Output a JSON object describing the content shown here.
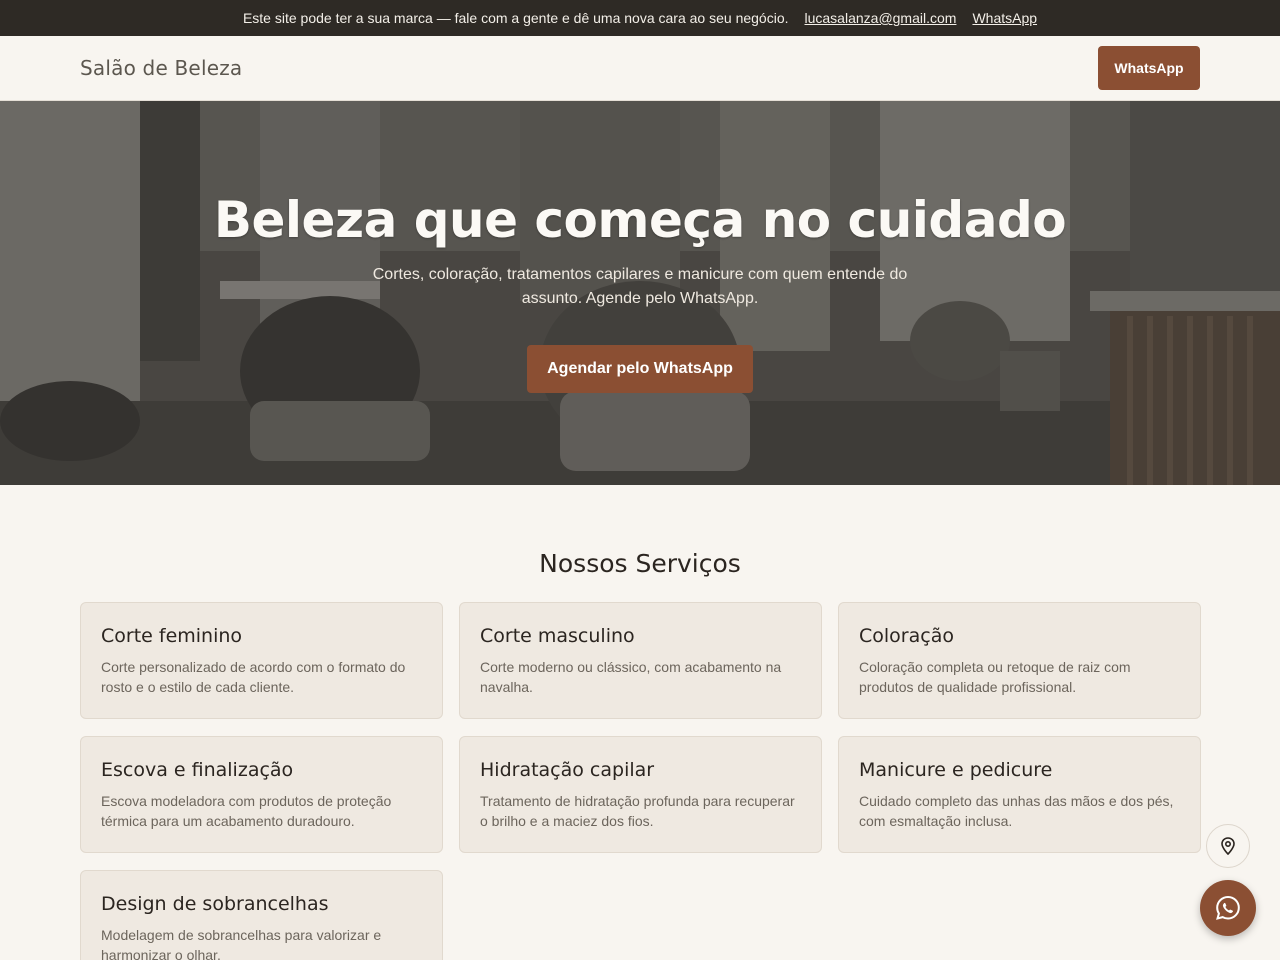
{
  "topbar": {
    "message": "Este site pode ter a sua marca — fale com a gente e dê uma nova cara ao seu negócio.",
    "email": "lucasalanza@gmail.com",
    "whatsapp_link": "WhatsApp"
  },
  "header": {
    "brand": "Salão de Beleza",
    "whatsapp_button": "WhatsApp"
  },
  "hero": {
    "title": "Beleza que começa no cuidado",
    "subtitle": "Cortes, coloração, tratamentos capilares e manicure com quem entende do assunto. Agende pelo WhatsApp.",
    "cta": "Agendar pelo WhatsApp"
  },
  "services": {
    "heading": "Nossos Serviços",
    "items": [
      {
        "title": "Corte feminino",
        "desc": "Corte personalizado de acordo com o formato do rosto e o estilo de cada cliente."
      },
      {
        "title": "Corte masculino",
        "desc": "Corte moderno ou clássico, com acabamento na navalha."
      },
      {
        "title": "Coloração",
        "desc": "Coloração completa ou retoque de raiz com produtos de qualidade profissional."
      },
      {
        "title": "Escova e finalização",
        "desc": "Escova modeladora com produtos de proteção térmica para um acabamento duradouro."
      },
      {
        "title": "Hidratação capilar",
        "desc": "Tratamento de hidratação profunda para recuperar o brilho e a maciez dos fios."
      },
      {
        "title": "Manicure e pedicure",
        "desc": "Cuidado completo das unhas das mãos e dos pés, com esmaltação inclusa."
      },
      {
        "title": "Design de sobrancelhas",
        "desc": "Modelagem de sobrancelhas para valorizar e harmonizar o olhar."
      }
    ]
  },
  "floating": {
    "location_icon": "map-pin-icon",
    "whatsapp_icon": "whatsapp-icon"
  },
  "colors": {
    "accent": "#8b4f33",
    "topbar": "#2e2a25",
    "background": "#f8f5f0",
    "card": "#efe9e1"
  }
}
